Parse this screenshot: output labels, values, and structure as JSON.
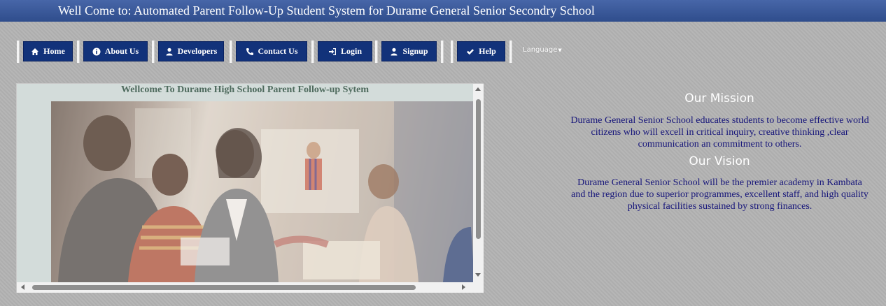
{
  "header": {
    "title": "Well Come to: Automated Parent Follow-Up Student System for Durame General Senior Secondry School"
  },
  "nav": {
    "items": [
      {
        "label": "Home",
        "icon": "home-icon"
      },
      {
        "label": "About Us",
        "icon": "info-icon"
      },
      {
        "label": "Developers",
        "icon": "user-icon"
      },
      {
        "label": "Contact Us",
        "icon": "phone-icon"
      },
      {
        "label": "Login",
        "icon": "sign-in-icon"
      },
      {
        "label": "Signup",
        "icon": "user-icon"
      },
      {
        "label": "Help",
        "icon": "check-icon"
      }
    ],
    "language": "Language"
  },
  "frame": {
    "welcome": "Wellcome To Durame High School Parent Follow-up Sytem"
  },
  "mission": {
    "heading": "Our Mission",
    "text": "Durame General Senior School educates students to become effective world citizens who will excell in critical inquiry, creative thinking ,clear communication an commitment to others."
  },
  "vision": {
    "heading": "Our Vision",
    "text": "Durame General Senior School will be the premier academy in Kambata and the region due to superior programmes, excellent staff, and high quality physical facilities sustained by strong finances."
  },
  "colors": {
    "header": "#3a5a9c",
    "nav_button": "#12327a",
    "heading": "#ffffff",
    "body_text": "#16157a"
  }
}
